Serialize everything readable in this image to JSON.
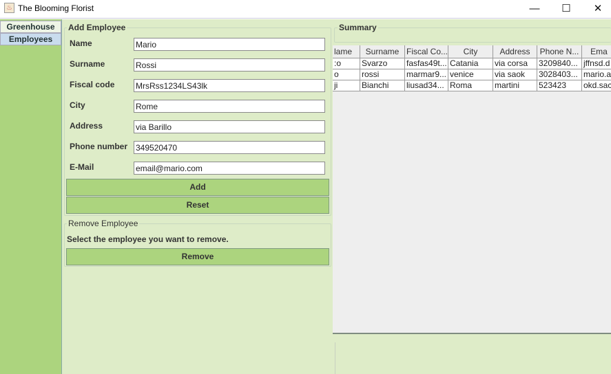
{
  "window": {
    "title": "The Blooming Florist",
    "minimize": "—",
    "maximize": "☐",
    "close": "✕"
  },
  "tabs": [
    {
      "label": "Greenhouse"
    },
    {
      "label": "Employees"
    }
  ],
  "add_employee": {
    "title": "Add Employee",
    "fields": [
      {
        "label": "Name",
        "value": "Mario"
      },
      {
        "label": "Surname",
        "value": "Rossi"
      },
      {
        "label": "Fiscal code",
        "value": "MrsRss1234LS43lk"
      },
      {
        "label": "City",
        "value": "Rome"
      },
      {
        "label": "Address",
        "value": "via Barillo"
      },
      {
        "label": "Phone number",
        "value": "349520470"
      },
      {
        "label": "E-Mail",
        "value": "email@mario.com"
      }
    ],
    "add_label": "Add",
    "reset_label": "Reset"
  },
  "remove_employee": {
    "title": "Remove Employee",
    "instruction": "Select the employee you want to remove.",
    "remove_label": "Remove"
  },
  "summary": {
    "title": "Summary",
    "columns": [
      "lame",
      "Surname",
      "Fiscal Co...",
      "City",
      "Address",
      "Phone N...",
      "Ema"
    ],
    "rows": [
      [
        ":o",
        "Svarzo",
        "fasfas49t...",
        "Catania",
        "via corsa",
        "3209840...",
        "jffnsd.d"
      ],
      [
        "o",
        "rossi",
        "marmar9...",
        "venice",
        "via saok",
        "3028403...",
        "mario.a"
      ],
      [
        "ji",
        "Bianchi",
        "liusad34...",
        "Roma",
        "martini",
        "523423",
        "okd.sac"
      ]
    ]
  }
}
